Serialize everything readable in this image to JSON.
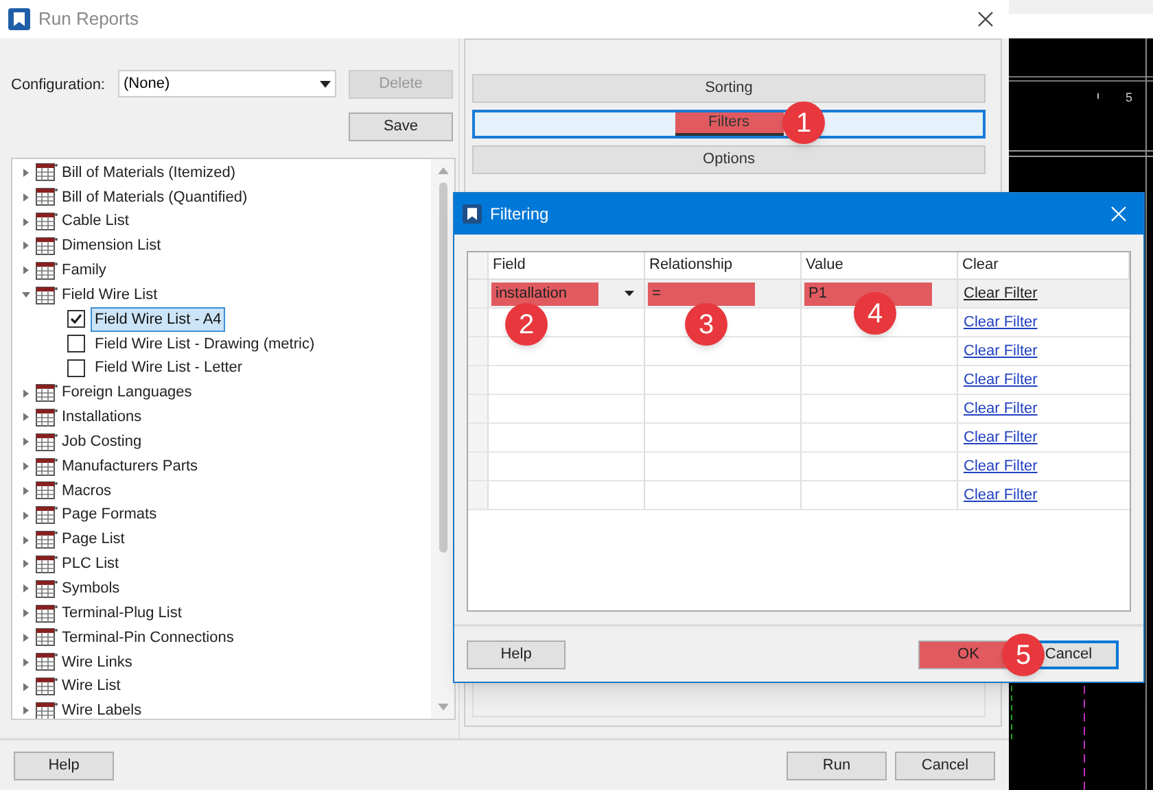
{
  "window": {
    "title": "Run Reports"
  },
  "configuration": {
    "label": "Configuration:",
    "value": "(None)"
  },
  "config_buttons": [
    {
      "label": "Delete",
      "disabled": true
    },
    {
      "label": "Save",
      "disabled": false
    }
  ],
  "report_tree": [
    {
      "label": "Bill of Materials (Itemized)",
      "expanded": false
    },
    {
      "label": "Bill of Materials (Quantified)",
      "expanded": false
    },
    {
      "label": "Cable List",
      "expanded": false
    },
    {
      "label": "Dimension List",
      "expanded": false
    },
    {
      "label": "Family",
      "expanded": false
    },
    {
      "label": "Field Wire List",
      "expanded": true,
      "children": [
        {
          "label": "Field Wire List - A4",
          "checked": true,
          "selected": true
        },
        {
          "label": "Field Wire List - Drawing (metric)",
          "checked": false,
          "selected": false
        },
        {
          "label": "Field Wire List - Letter",
          "checked": false,
          "selected": false
        }
      ]
    },
    {
      "label": "Foreign Languages",
      "expanded": false
    },
    {
      "label": "Installations",
      "expanded": false
    },
    {
      "label": "Job Costing",
      "expanded": false
    },
    {
      "label": "Manufacturers Parts",
      "expanded": false
    },
    {
      "label": "Macros",
      "expanded": false
    },
    {
      "label": "Page Formats",
      "expanded": false
    },
    {
      "label": "Page List",
      "expanded": false
    },
    {
      "label": "PLC List",
      "expanded": false
    },
    {
      "label": "Symbols",
      "expanded": false
    },
    {
      "label": "Terminal-Plug List",
      "expanded": false
    },
    {
      "label": "Terminal-Pin Connections",
      "expanded": false
    },
    {
      "label": "Wire Links",
      "expanded": false
    },
    {
      "label": "Wire List",
      "expanded": false
    },
    {
      "label": "Wire Labels",
      "expanded": false
    }
  ],
  "sections": [
    {
      "label": "Sorting",
      "selected": false,
      "highlighted": false
    },
    {
      "label": "Filters",
      "selected": true,
      "highlighted": true
    },
    {
      "label": "Options",
      "selected": false,
      "highlighted": false
    }
  ],
  "footer_buttons": [
    {
      "label": "Help"
    },
    {
      "label": "Run"
    },
    {
      "label": "Cancel"
    }
  ],
  "filtering": {
    "title": "Filtering",
    "columns": [
      "Field",
      "Relationship",
      "Value",
      "Clear"
    ],
    "rows": [
      {
        "field": "installation",
        "relationship": "=",
        "value": "P1",
        "clear": "Clear Filter",
        "selected": true,
        "highlighted": true
      },
      {
        "clear": "Clear Filter",
        "selected": false
      },
      {
        "clear": "Clear Filter",
        "selected": false
      },
      {
        "clear": "Clear Filter",
        "selected": false
      },
      {
        "clear": "Clear Filter",
        "selected": false
      },
      {
        "clear": "Clear Filter",
        "selected": false
      },
      {
        "clear": "Clear Filter",
        "selected": false
      },
      {
        "clear": "Clear Filter",
        "selected": false
      }
    ],
    "buttons": [
      {
        "label": "Help",
        "highlighted": false,
        "default": false
      },
      {
        "label": "OK",
        "highlighted": true,
        "default": false
      },
      {
        "label": "Cancel",
        "highlighted": false,
        "default": true
      }
    ]
  },
  "annotations": [
    {
      "number": "1"
    },
    {
      "number": "2"
    },
    {
      "number": "3"
    },
    {
      "number": "4"
    },
    {
      "number": "5"
    }
  ],
  "cad": {
    "label": "5"
  }
}
